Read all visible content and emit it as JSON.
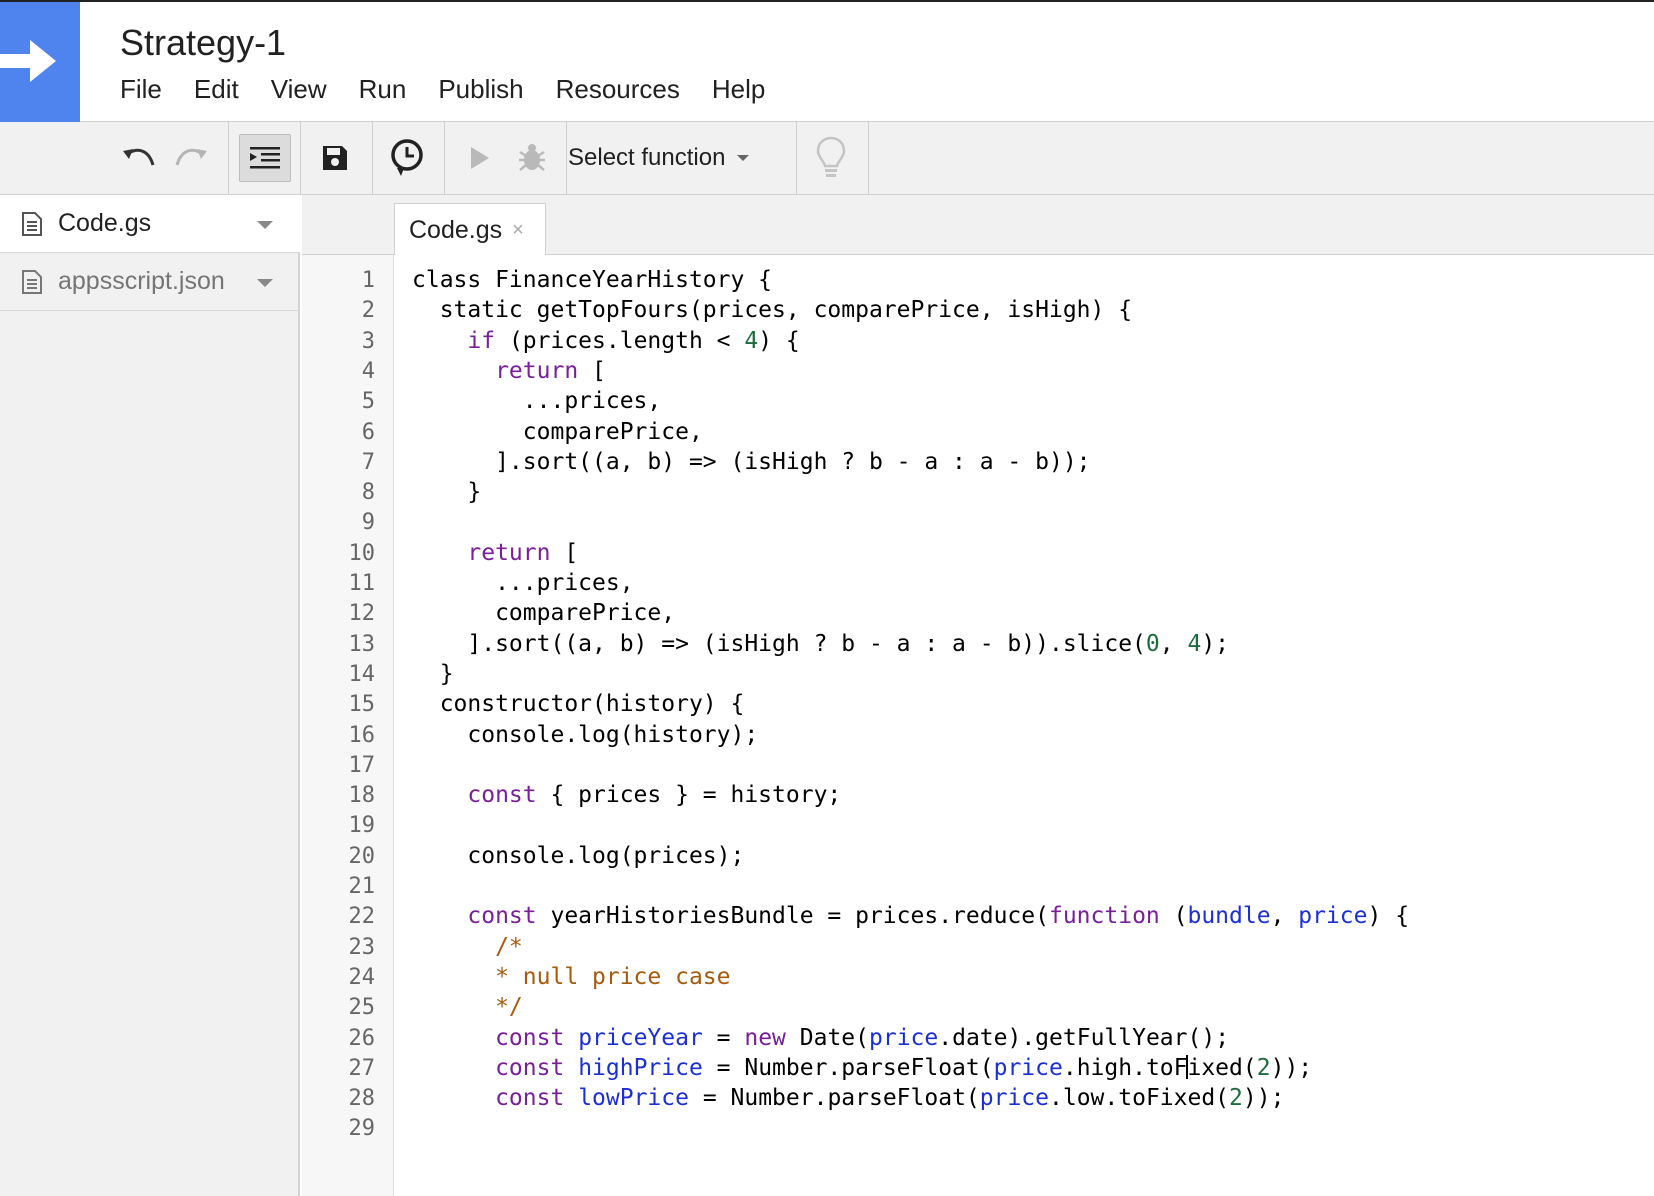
{
  "app": {
    "title": "Strategy-1"
  },
  "menu": [
    "File",
    "Edit",
    "View",
    "Run",
    "Publish",
    "Resources",
    "Help"
  ],
  "toolbar": {
    "select_function": "Select function",
    "icons": [
      "undo-icon",
      "redo-icon",
      "indent-icon",
      "save-icon",
      "triggers-clock-icon",
      "run-icon",
      "debug-bug-icon",
      "lightbulb-icon"
    ]
  },
  "files": [
    {
      "name": "Code.gs"
    },
    {
      "name": "appsscript.json"
    }
  ],
  "tabs": [
    {
      "label": "Code.gs",
      "close": "×"
    }
  ],
  "editor": {
    "line_numbers": [
      "1",
      "2",
      "3",
      "4",
      "5",
      "6",
      "7",
      "8",
      "9",
      "10",
      "11",
      "12",
      "13",
      "14",
      "15",
      "16",
      "17",
      "18",
      "19",
      "20",
      "21",
      "22",
      "23",
      "24",
      "25",
      "26",
      "27",
      "28",
      "29"
    ],
    "lines": [
      [
        [
          "t",
          "class FinanceYearHistory {"
        ]
      ],
      [
        [
          "t",
          "  static getTopFours(prices, comparePrice, isHigh) {"
        ]
      ],
      [
        [
          "k",
          "    if"
        ],
        [
          "t",
          " (prices.length < "
        ],
        [
          "n",
          "4"
        ],
        [
          "t",
          ") {"
        ]
      ],
      [
        [
          "k",
          "      return"
        ],
        [
          "t",
          " ["
        ]
      ],
      [
        [
          "t",
          "        ...prices,"
        ]
      ],
      [
        [
          "t",
          "        comparePrice,"
        ]
      ],
      [
        [
          "t",
          "      ].sort((a, b) => (isHigh ? b - a : a - b));"
        ]
      ],
      [
        [
          "t",
          "    }"
        ]
      ],
      [],
      [
        [
          "k",
          "    return"
        ],
        [
          "t",
          " ["
        ]
      ],
      [
        [
          "t",
          "      ...prices,"
        ]
      ],
      [
        [
          "t",
          "      comparePrice,"
        ]
      ],
      [
        [
          "t",
          "    ].sort((a, b) => (isHigh ? b - a : a - b)).slice("
        ],
        [
          "n",
          "0"
        ],
        [
          "t",
          ", "
        ],
        [
          "n",
          "4"
        ],
        [
          "t",
          ");"
        ]
      ],
      [
        [
          "t",
          "  }"
        ]
      ],
      [
        [
          "t",
          "  constructor(history) {"
        ]
      ],
      [
        [
          "t",
          "    console.log(history);"
        ]
      ],
      [],
      [
        [
          "k",
          "    const"
        ],
        [
          "t",
          " { prices } = history;"
        ]
      ],
      [],
      [
        [
          "t",
          "    console.log(prices);"
        ]
      ],
      [],
      [
        [
          "k",
          "    const"
        ],
        [
          "t",
          " yearHistoriesBundle = prices.reduce("
        ],
        [
          "k",
          "function"
        ],
        [
          "t",
          " ("
        ],
        [
          "v",
          "bundle"
        ],
        [
          "t",
          ", "
        ],
        [
          "v",
          "price"
        ],
        [
          "t",
          ") {"
        ]
      ],
      [
        [
          "c",
          "      /*"
        ]
      ],
      [
        [
          "c",
          "      * null price case"
        ]
      ],
      [
        [
          "c",
          "      */"
        ]
      ],
      [
        [
          "k",
          "      const"
        ],
        [
          "t",
          " "
        ],
        [
          "v",
          "priceYear"
        ],
        [
          "t",
          " = "
        ],
        [
          "k",
          "new"
        ],
        [
          "t",
          " Date("
        ],
        [
          "v",
          "price"
        ],
        [
          "t",
          ".date).getFullYear();"
        ]
      ],
      [
        [
          "k",
          "      const"
        ],
        [
          "t",
          " "
        ],
        [
          "v",
          "highPrice"
        ],
        [
          "t",
          " = Number.parseFloat("
        ],
        [
          "v",
          "price"
        ],
        [
          "t",
          ".high.toF"
        ],
        [
          "cursor",
          ""
        ],
        [
          "t",
          "ixed("
        ],
        [
          "n",
          "2"
        ],
        [
          "t",
          "));"
        ]
      ],
      [
        [
          "k",
          "      const"
        ],
        [
          "t",
          " "
        ],
        [
          "v",
          "lowPrice"
        ],
        [
          "t",
          " = Number.parseFloat("
        ],
        [
          "v",
          "price"
        ],
        [
          "t",
          ".low.toFixed("
        ],
        [
          "n",
          "2"
        ],
        [
          "t",
          "));"
        ]
      ],
      []
    ]
  }
}
